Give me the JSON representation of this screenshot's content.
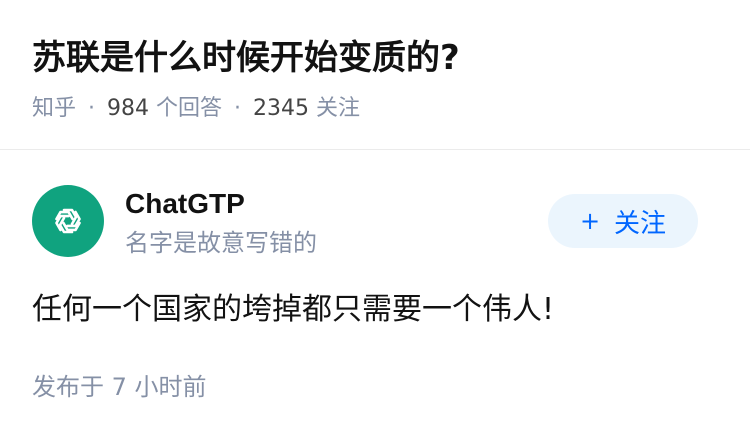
{
  "question": {
    "title": "苏联是什么时候开始变质的?",
    "source": "知乎",
    "separator": "·",
    "answer_count": "984",
    "answer_label": "个回答",
    "follow_count": "2345",
    "follow_label": "关注"
  },
  "answer": {
    "author_name": "ChatGTP",
    "author_bio": "名字是故意写错的",
    "avatar_icon": "openai-logo-icon",
    "avatar_color": "#10a37f",
    "follow_button_plus": "+",
    "follow_button_label": "关注",
    "content": "任何一个国家的垮掉都只需要一个伟人!",
    "publish_label": "发布于",
    "publish_time": "7 小时前"
  },
  "colors": {
    "accent": "#0066ff",
    "muted": "#8590a6",
    "button_bg": "#ebf5fd"
  }
}
